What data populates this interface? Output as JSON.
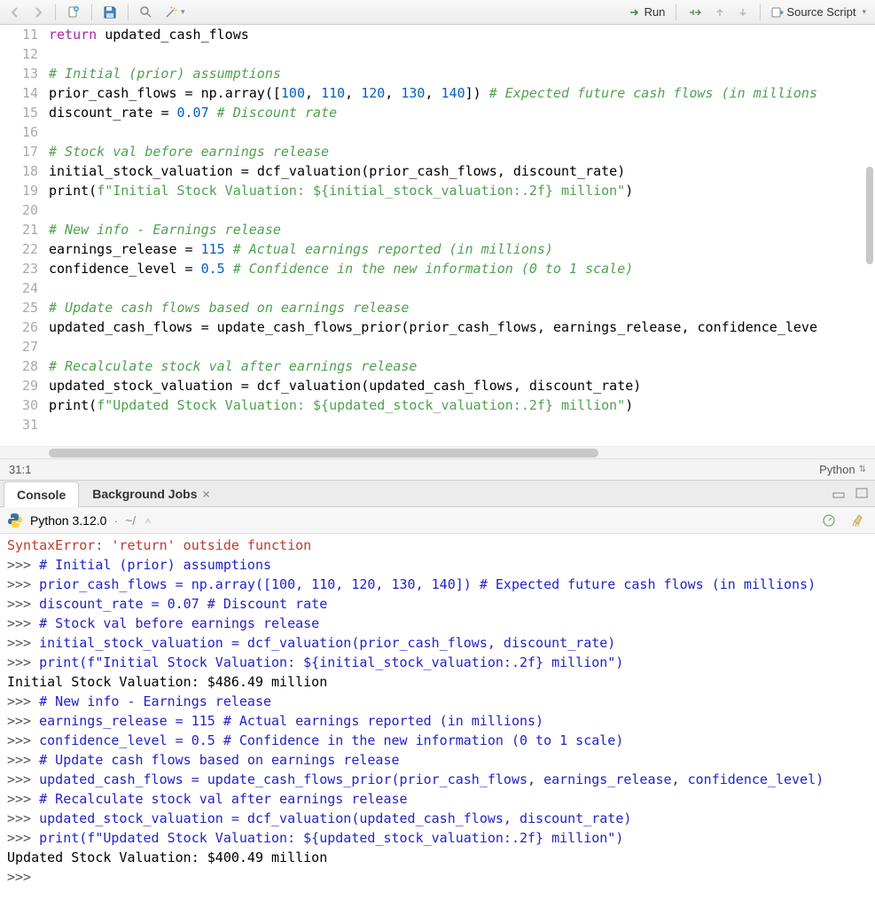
{
  "toolbar": {
    "run_label": "Run",
    "source_label": "Source Script"
  },
  "editor": {
    "lines": [
      {
        "n": 11,
        "tokens": [
          [
            "kw",
            "return"
          ],
          [
            "var",
            " updated_cash_flows"
          ]
        ]
      },
      {
        "n": 12,
        "tokens": []
      },
      {
        "n": 13,
        "tokens": [
          [
            "com",
            "# Initial (prior) assumptions"
          ]
        ]
      },
      {
        "n": 14,
        "tokens": [
          [
            "var",
            "prior_cash_flows "
          ],
          [
            "op",
            "= "
          ],
          [
            "mod",
            "np"
          ],
          [
            "op",
            "."
          ],
          [
            "fn",
            "array"
          ],
          [
            "op",
            "(["
          ],
          [
            "num",
            "100"
          ],
          [
            "op",
            ", "
          ],
          [
            "num",
            "110"
          ],
          [
            "op",
            ", "
          ],
          [
            "num",
            "120"
          ],
          [
            "op",
            ", "
          ],
          [
            "num",
            "130"
          ],
          [
            "op",
            ", "
          ],
          [
            "num",
            "140"
          ],
          [
            "op",
            "]) "
          ],
          [
            "com",
            "# Expected future cash flows (in millions"
          ]
        ]
      },
      {
        "n": 15,
        "tokens": [
          [
            "var",
            "discount_rate "
          ],
          [
            "op",
            "= "
          ],
          [
            "num",
            "0.07"
          ],
          [
            "op",
            " "
          ],
          [
            "com",
            "# Discount rate"
          ]
        ]
      },
      {
        "n": 16,
        "tokens": []
      },
      {
        "n": 17,
        "tokens": [
          [
            "com",
            "# Stock val before earnings release"
          ]
        ]
      },
      {
        "n": 18,
        "tokens": [
          [
            "var",
            "initial_stock_valuation "
          ],
          [
            "op",
            "= "
          ],
          [
            "fn",
            "dcf_valuation"
          ],
          [
            "op",
            "("
          ],
          [
            "var",
            "prior_cash_flows"
          ],
          [
            "op",
            ", "
          ],
          [
            "var",
            "discount_rate"
          ],
          [
            "op",
            ")"
          ]
        ]
      },
      {
        "n": 19,
        "tokens": [
          [
            "fn",
            "print"
          ],
          [
            "op",
            "("
          ],
          [
            "str",
            "f\"Initial Stock Valuation: ${initial_stock_valuation:.2f} million\""
          ],
          [
            "op",
            ")"
          ]
        ]
      },
      {
        "n": 20,
        "tokens": []
      },
      {
        "n": 21,
        "tokens": [
          [
            "com",
            "# New info - Earnings release"
          ]
        ]
      },
      {
        "n": 22,
        "tokens": [
          [
            "var",
            "earnings_release "
          ],
          [
            "op",
            "= "
          ],
          [
            "num",
            "115"
          ],
          [
            "op",
            " "
          ],
          [
            "com",
            "# Actual earnings reported (in millions)"
          ]
        ]
      },
      {
        "n": 23,
        "tokens": [
          [
            "var",
            "confidence_level "
          ],
          [
            "op",
            "= "
          ],
          [
            "num",
            "0.5"
          ],
          [
            "op",
            " "
          ],
          [
            "com",
            "# Confidence in the new information (0 to 1 scale)"
          ]
        ]
      },
      {
        "n": 24,
        "tokens": []
      },
      {
        "n": 25,
        "tokens": [
          [
            "com",
            "# Update cash flows based on earnings release"
          ]
        ]
      },
      {
        "n": 26,
        "tokens": [
          [
            "var",
            "updated_cash_flows "
          ],
          [
            "op",
            "= "
          ],
          [
            "fn",
            "update_cash_flows_prior"
          ],
          [
            "op",
            "("
          ],
          [
            "var",
            "prior_cash_flows"
          ],
          [
            "op",
            ", "
          ],
          [
            "var",
            "earnings_release"
          ],
          [
            "op",
            ", "
          ],
          [
            "var",
            "confidence_leve"
          ]
        ]
      },
      {
        "n": 27,
        "tokens": []
      },
      {
        "n": 28,
        "tokens": [
          [
            "com",
            "# Recalculate stock val after earnings release"
          ]
        ]
      },
      {
        "n": 29,
        "tokens": [
          [
            "var",
            "updated_stock_valuation "
          ],
          [
            "op",
            "= "
          ],
          [
            "fn",
            "dcf_valuation"
          ],
          [
            "op",
            "("
          ],
          [
            "var",
            "updated_cash_flows"
          ],
          [
            "op",
            ", "
          ],
          [
            "var",
            "discount_rate"
          ],
          [
            "op",
            ")"
          ]
        ]
      },
      {
        "n": 30,
        "tokens": [
          [
            "fn",
            "print"
          ],
          [
            "op",
            "("
          ],
          [
            "str",
            "f\"Updated Stock Valuation: ${updated_stock_valuation:.2f} million\""
          ],
          [
            "op",
            ")"
          ]
        ]
      },
      {
        "n": 31,
        "tokens": []
      }
    ],
    "cursor": "31:1",
    "language": "Python"
  },
  "tabs": {
    "console_label": "Console",
    "bgjobs_label": "Background Jobs"
  },
  "console_header": {
    "title": "Python 3.12.0",
    "path": "~/"
  },
  "console": {
    "lines": [
      {
        "cls": "err",
        "text": "SyntaxError: 'return' outside function"
      },
      {
        "cls": "inp",
        "prompt": ">>> ",
        "text": "# Initial (prior) assumptions"
      },
      {
        "cls": "inp",
        "prompt": ">>> ",
        "text": "prior_cash_flows = np.array([100, 110, 120, 130, 140]) # Expected future cash flows (in millions)"
      },
      {
        "cls": "inp",
        "prompt": ">>> ",
        "text": "discount_rate = 0.07 # Discount rate"
      },
      {
        "cls": "inp",
        "prompt": ">>> ",
        "text": "# Stock val before earnings release"
      },
      {
        "cls": "inp",
        "prompt": ">>> ",
        "text": "initial_stock_valuation = dcf_valuation(prior_cash_flows, discount_rate)"
      },
      {
        "cls": "inp",
        "prompt": ">>> ",
        "text": "print(f\"Initial Stock Valuation: ${initial_stock_valuation:.2f} million\")"
      },
      {
        "cls": "out",
        "text": "Initial Stock Valuation: $486.49 million"
      },
      {
        "cls": "inp",
        "prompt": ">>> ",
        "text": "# New info - Earnings release"
      },
      {
        "cls": "inp",
        "prompt": ">>> ",
        "text": "earnings_release = 115 # Actual earnings reported (in millions)"
      },
      {
        "cls": "inp",
        "prompt": ">>> ",
        "text": "confidence_level = 0.5 # Confidence in the new information (0 to 1 scale)"
      },
      {
        "cls": "inp",
        "prompt": ">>> ",
        "text": "# Update cash flows based on earnings release"
      },
      {
        "cls": "inp",
        "prompt": ">>> ",
        "text": "updated_cash_flows = update_cash_flows_prior(prior_cash_flows, earnings_release, confidence_level)"
      },
      {
        "cls": "inp",
        "prompt": ">>> ",
        "text": "# Recalculate stock val after earnings release"
      },
      {
        "cls": "inp",
        "prompt": ">>> ",
        "text": "updated_stock_valuation = dcf_valuation(updated_cash_flows, discount_rate)"
      },
      {
        "cls": "inp",
        "prompt": ">>> ",
        "text": "print(f\"Updated Stock Valuation: ${updated_stock_valuation:.2f} million\")"
      },
      {
        "cls": "out",
        "text": "Updated Stock Valuation: $400.49 million"
      },
      {
        "cls": "inp",
        "prompt": ">>> ",
        "text": ""
      }
    ]
  }
}
